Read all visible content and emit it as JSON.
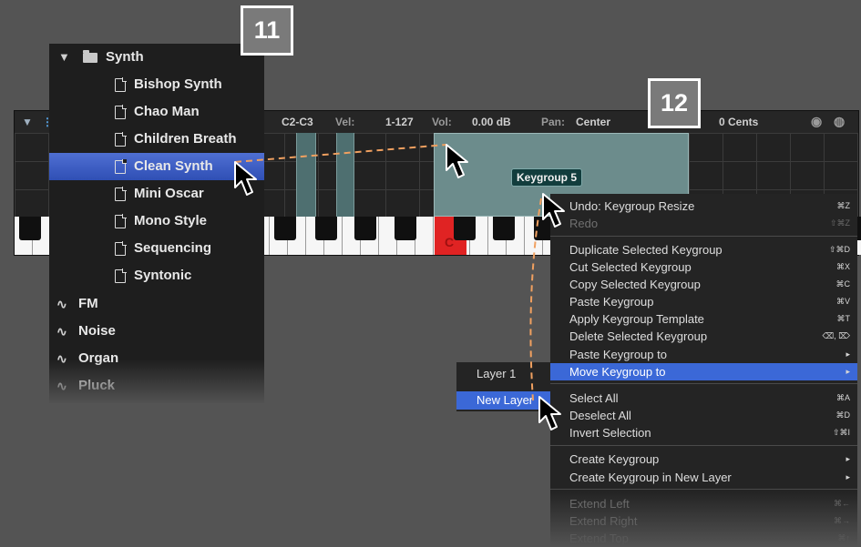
{
  "editor": {
    "toolbar": {
      "range": "C2-C3",
      "vel_label": "Vel:",
      "vel_value": "1-127",
      "vol_label": "Vol:",
      "vol_value": "0.00 dB",
      "pan_label": "Pan:",
      "pan_value": "Center",
      "cents_value": "0 Cents"
    },
    "keygroup_label": "Keygroup 5",
    "key_note": "C"
  },
  "browser": {
    "folder": "Synth",
    "files": [
      "Bishop Synth",
      "Chao Man",
      "Children Breath",
      "Clean Synth",
      "Mini Oscar",
      "Mono Style",
      "Sequencing",
      "Syntonic"
    ],
    "selected_file": "Clean Synth",
    "categories": [
      "FM",
      "Noise",
      "Organ",
      "Pluck"
    ]
  },
  "callouts": {
    "step_11": "11",
    "step_12": "12"
  },
  "context_menu": {
    "items": [
      {
        "label": "Undo: Keygroup Resize",
        "shortcut": "⌘Z",
        "disabled": false
      },
      {
        "label": "Redo",
        "shortcut": "⇧⌘Z",
        "disabled": true
      },
      {
        "label": "Duplicate Selected Keygroup",
        "shortcut": "⇧⌘D",
        "disabled": false
      },
      {
        "label": "Cut Selected Keygroup",
        "shortcut": "⌘X",
        "disabled": false
      },
      {
        "label": "Copy Selected Keygroup",
        "shortcut": "⌘C",
        "disabled": false
      },
      {
        "label": "Paste Keygroup",
        "shortcut": "⌘V",
        "disabled": false
      },
      {
        "label": "Apply Keygroup Template",
        "shortcut": "⌘T",
        "disabled": false
      },
      {
        "label": "Delete Selected Keygroup",
        "shortcut": "⌫, ⌦",
        "disabled": false
      },
      {
        "label": "Paste Keygroup to",
        "shortcut": "▸",
        "disabled": false
      },
      {
        "label": "Move Keygroup to",
        "shortcut": "▸",
        "disabled": false,
        "highlighted": true
      },
      {
        "label": "Select All",
        "shortcut": "⌘A",
        "disabled": false
      },
      {
        "label": "Deselect All",
        "shortcut": "⌘D",
        "disabled": false
      },
      {
        "label": "Invert Selection",
        "shortcut": "⇧⌘I",
        "disabled": false
      },
      {
        "label": "Create Keygroup",
        "shortcut": "▸",
        "disabled": false
      },
      {
        "label": "Create Keygroup in New Layer",
        "shortcut": "▸",
        "disabled": false
      },
      {
        "label": "Extend Left",
        "shortcut": "⌘←",
        "disabled": true
      },
      {
        "label": "Extend Right",
        "shortcut": "⌘→",
        "disabled": true
      },
      {
        "label": "Extend Top",
        "shortcut": "⌘↑",
        "disabled": true
      }
    ]
  },
  "submenu": {
    "items": [
      "Layer 1",
      "New Layer"
    ],
    "highlighted": "New Layer"
  },
  "colors": {
    "accent": "#3b68d7",
    "selection": "#3a5bc7",
    "keygroup": "#6c8c8c",
    "dashed_line": "#f0a060",
    "active_key": "#e02323"
  }
}
